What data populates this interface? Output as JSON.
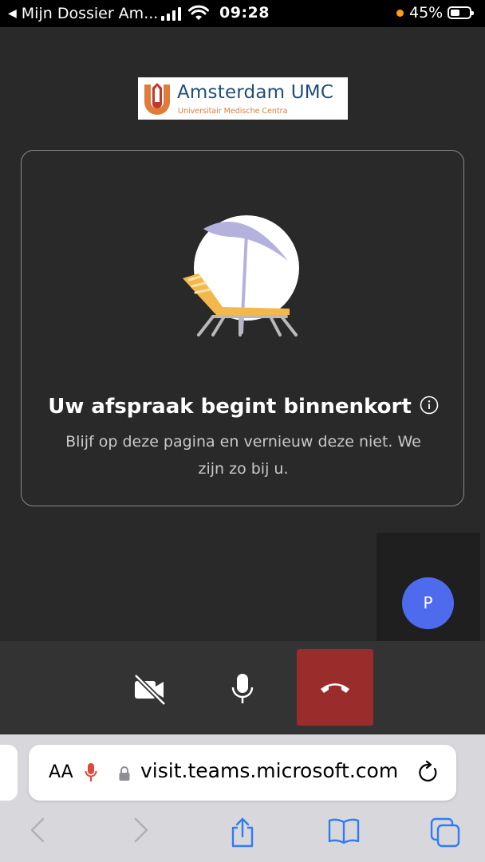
{
  "status_bar": {
    "back_label": "Mijn Dossier Am...",
    "time": "09:28",
    "battery": "45%",
    "icons": [
      "signal-icon",
      "wifi-icon",
      "orange-dot-icon",
      "battery-icon"
    ]
  },
  "logo": {
    "name": "Amsterdam UMC",
    "subtitle": "Universitair Medische Centra"
  },
  "card": {
    "title": "Uw afspraak begint binnenkort",
    "message": "Blijf op deze pagina en vernieuw deze niet. We zijn zo bij u."
  },
  "participant": {
    "initial": "P"
  },
  "call_controls": {
    "buttons": [
      "camera-off-icon",
      "microphone-icon",
      "hang-up-icon"
    ],
    "hangup_color": "#9b2c2c"
  },
  "browser": {
    "text_size_label": "AA",
    "url": "visit.teams.microsoft.com",
    "toolbar": [
      "back-icon",
      "forward-icon",
      "share-icon",
      "bookmarks-icon",
      "tabs-icon"
    ]
  },
  "colors": {
    "background": "#292929",
    "avatar": "#4f6bed",
    "logo_blue": "#1f4e79",
    "logo_orange": "#e07b39"
  }
}
